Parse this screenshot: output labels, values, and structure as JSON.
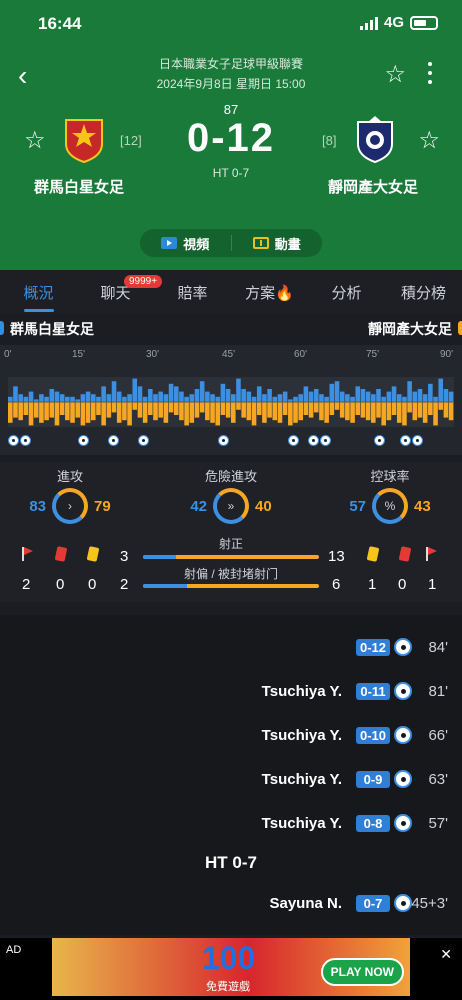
{
  "status": {
    "time": "16:44",
    "network": "4G"
  },
  "match": {
    "league": "日本職業女子足球甲級聯賽",
    "datetime": "2024年9月8日 星期日 15:00",
    "minute": "87",
    "score": "0-12",
    "halftime": "HT 0-7",
    "home": {
      "name": "群馬白星女足",
      "rank": "[12]"
    },
    "away": {
      "name": "靜岡產大女足",
      "rank": "[8]"
    }
  },
  "media": {
    "video": "視頻",
    "animation": "動畫"
  },
  "tabs": [
    {
      "label": "概況"
    },
    {
      "label": "聊天"
    },
    {
      "label": "賠率"
    },
    {
      "label": "方案🔥"
    },
    {
      "label": "分析"
    },
    {
      "label": "積分榜"
    }
  ],
  "chat_badge": "9999+",
  "timeline": {
    "ticks": [
      "0'",
      "15'",
      "30'",
      "45'",
      "60'",
      "75'",
      "90'"
    ],
    "home_pressure": [
      2,
      6,
      3,
      2,
      4,
      1,
      3,
      2,
      5,
      4,
      3,
      2,
      2,
      1,
      3,
      4,
      3,
      2,
      6,
      3,
      8,
      4,
      2,
      3,
      9,
      6,
      2,
      5,
      3,
      4,
      3,
      7,
      6,
      4,
      2,
      3,
      5,
      8,
      4,
      3,
      2,
      7,
      5,
      3,
      9,
      5,
      4,
      2,
      6,
      3,
      5,
      2,
      3,
      4,
      1,
      2,
      3,
      6,
      4,
      5,
      3,
      2,
      7,
      8,
      4,
      3,
      2,
      6,
      5,
      4,
      3,
      5,
      2,
      4,
      6,
      3,
      2,
      8,
      4,
      5,
      3,
      7,
      2,
      9,
      5,
      4
    ],
    "away_pressure": [
      8,
      6,
      7,
      5,
      9,
      6,
      8,
      7,
      6,
      9,
      5,
      7,
      8,
      6,
      9,
      8,
      7,
      5,
      9,
      6,
      4,
      8,
      7,
      9,
      3,
      6,
      8,
      5,
      7,
      6,
      8,
      4,
      5,
      7,
      9,
      8,
      6,
      4,
      7,
      8,
      9,
      5,
      6,
      8,
      3,
      6,
      7,
      9,
      5,
      8,
      6,
      7,
      8,
      5,
      9,
      8,
      7,
      5,
      6,
      4,
      7,
      8,
      5,
      3,
      6,
      7,
      8,
      5,
      6,
      7,
      8,
      6,
      9,
      7,
      5,
      8,
      9,
      4,
      7,
      6,
      8,
      5,
      9,
      3,
      6,
      7
    ]
  },
  "stats": {
    "attack": {
      "label": "進攻",
      "home": "83",
      "away": "79",
      "home_frac": 0.51
    },
    "dangerous": {
      "label": "危險進攻",
      "home": "42",
      "away": "40",
      "home_frac": 0.51
    },
    "possession": {
      "label": "控球率",
      "home": "57",
      "away": "43",
      "home_frac": 0.57
    },
    "home_cards": {
      "corners": "2",
      "red": "0",
      "yellow": "0"
    },
    "away_cards": {
      "corners": "1",
      "red": "0",
      "yellow": "1"
    },
    "on_target": {
      "label": "射正",
      "home": "3",
      "away": "13",
      "home_frac": 0.19
    },
    "off_target": {
      "label": "射偏 / 被封堵射门",
      "home": "2",
      "away": "6",
      "home_frac": 0.25
    }
  },
  "events": [
    {
      "player": "",
      "score": "0-12",
      "minute": "84'"
    },
    {
      "player": "Tsuchiya Y.",
      "score": "0-11",
      "minute": "81'"
    },
    {
      "player": "Tsuchiya Y.",
      "score": "0-10",
      "minute": "66'"
    },
    {
      "player": "Tsuchiya Y.",
      "score": "0-9",
      "minute": "63'"
    },
    {
      "player": "Tsuchiya Y.",
      "score": "0-8",
      "minute": "57'"
    },
    {
      "player": "Sayuna N.",
      "score": "0-7",
      "minute": "45+3'"
    }
  ],
  "ht_marker": "HT 0-7",
  "ad": {
    "label": "AD",
    "headline": "100",
    "sub": "免費遊戲",
    "cta": "PLAY NOW"
  },
  "colors": {
    "header": "#1a7a3a",
    "home": "#3d8fe0",
    "away": "#f5a623"
  }
}
